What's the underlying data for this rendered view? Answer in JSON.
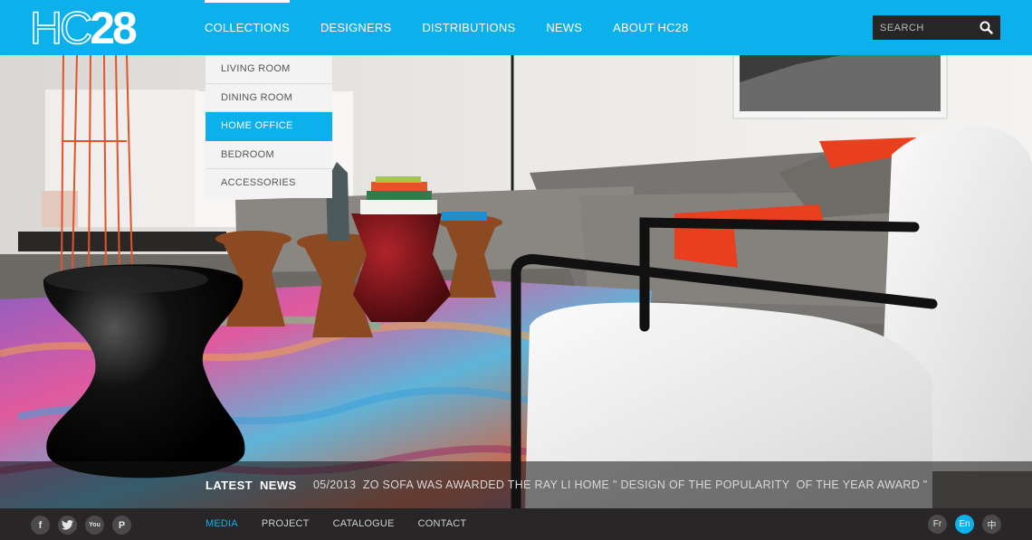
{
  "logo": {
    "outline_text": "HC",
    "solid_text": "28"
  },
  "nav": {
    "items": [
      {
        "label": "COLLECTIONS",
        "active": true
      },
      {
        "label": "DESIGNERS"
      },
      {
        "label": "DISTRIBUTIONS"
      },
      {
        "label": "NEWS"
      },
      {
        "label": "ABOUT HC28"
      }
    ]
  },
  "search": {
    "placeholder": "SEARCH",
    "icon": "search-icon"
  },
  "dropdown": {
    "items": [
      {
        "label": "LIVING ROOM"
      },
      {
        "label": "DINING ROOM"
      },
      {
        "label": "HOME OFFICE",
        "selected": true
      },
      {
        "label": "BEDROOM"
      },
      {
        "label": "ACCESSORIES"
      }
    ]
  },
  "news": {
    "title_part1": "LATEST",
    "title_part2": "NEWS",
    "text": "05/2013  ZO SOFA WAS AWARDED THE RAY LI HOME \" DESIGN OF THE POPULARITY  OF THE YEAR AWARD \""
  },
  "footer": {
    "social": [
      {
        "icon": "facebook-icon",
        "glyph": "f"
      },
      {
        "icon": "twitter-icon",
        "glyph": "t"
      },
      {
        "icon": "youtube-icon",
        "glyph": "You"
      },
      {
        "icon": "pinterest-icon",
        "glyph": "P"
      }
    ],
    "links": [
      {
        "label": "MEDIA",
        "active": true
      },
      {
        "label": "PROJECT"
      },
      {
        "label": "CATALOGUE"
      },
      {
        "label": "CONTACT"
      }
    ],
    "languages": [
      {
        "label": "Fr"
      },
      {
        "label": "En",
        "active": true
      },
      {
        "label": "中"
      }
    ]
  },
  "colors": {
    "accent": "#0cb1ec",
    "footer": "#282626",
    "dropdown": "#f3f3f3"
  }
}
